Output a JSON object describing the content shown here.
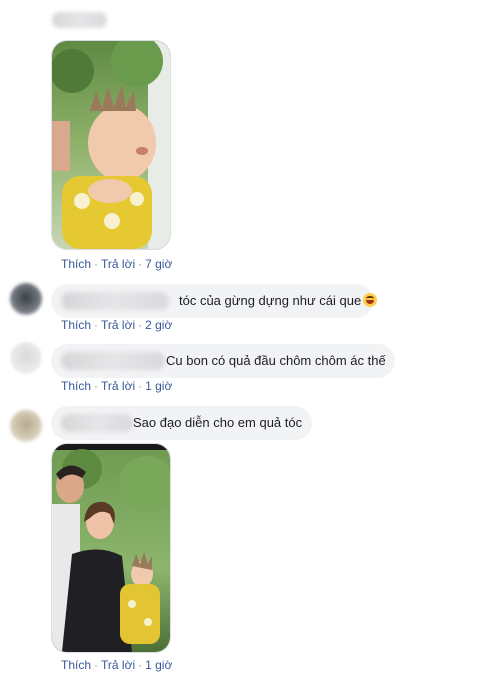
{
  "comments": [
    {
      "meta": {
        "like": "Thích",
        "reply": "Trả lời",
        "time": "7 giờ"
      }
    },
    {
      "text": "tóc của gừng dựng như cái que",
      "emoji": "laughing-emoji",
      "meta": {
        "like": "Thích",
        "reply": "Trả lời",
        "time": "2 giờ"
      }
    },
    {
      "text": "Cu bon có quả đầu chôm chôm ác thế",
      "meta": {
        "like": "Thích",
        "reply": "Trả lời",
        "time": "1 giờ"
      }
    },
    {
      "text": "Sao đạo diễn cho em quả tóc",
      "meta": {
        "like": "Thích",
        "reply": "Trả lời",
        "time": "1 giờ"
      }
    }
  ],
  "separator": "·",
  "colors": {
    "bubble": "#f2f3f5",
    "link": "#385898",
    "meta": "#606770"
  }
}
